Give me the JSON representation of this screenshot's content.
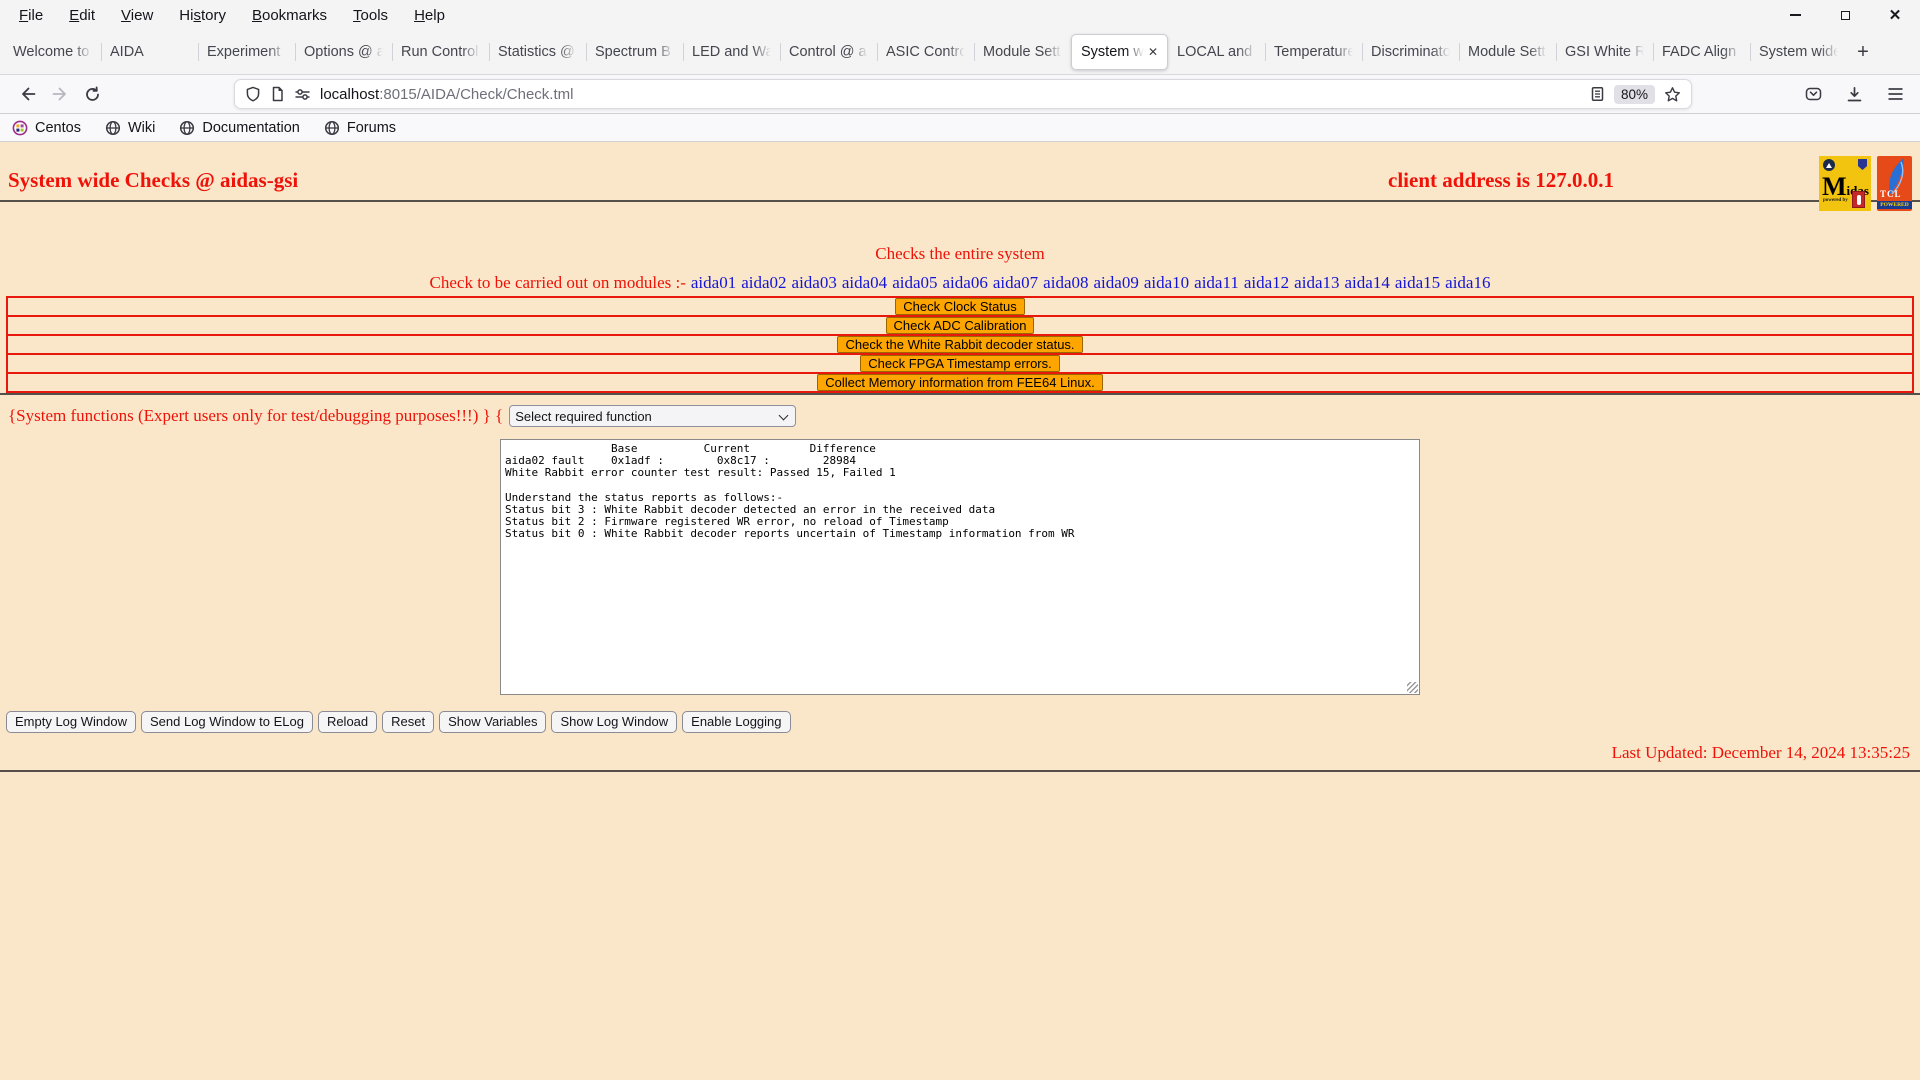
{
  "window": {
    "menu": [
      {
        "label": "File",
        "underline": 0
      },
      {
        "label": "Edit",
        "underline": 0
      },
      {
        "label": "View",
        "underline": 0
      },
      {
        "label": "History",
        "underline": 2
      },
      {
        "label": "Bookmarks",
        "underline": 0
      },
      {
        "label": "Tools",
        "underline": 0
      },
      {
        "label": "Help",
        "underline": 0
      }
    ],
    "controls": {
      "minimize": "minimize",
      "maximize": "maximize",
      "close": "close"
    }
  },
  "tabs": {
    "items": [
      {
        "label": "Welcome to",
        "active": false
      },
      {
        "label": "AIDA",
        "active": false
      },
      {
        "label": "Experiment",
        "active": false
      },
      {
        "label": "Options @ a",
        "active": false
      },
      {
        "label": "Run Control",
        "active": false
      },
      {
        "label": "Statistics @",
        "active": false
      },
      {
        "label": "Spectrum B",
        "active": false
      },
      {
        "label": "LED and Wa",
        "active": false
      },
      {
        "label": "Control @ a",
        "active": false
      },
      {
        "label": "ASIC Contro",
        "active": false
      },
      {
        "label": "Module Sett",
        "active": false
      },
      {
        "label": "System w",
        "active": true
      },
      {
        "label": "LOCAL and",
        "active": false
      },
      {
        "label": "Temperature",
        "active": false
      },
      {
        "label": "Discriminato",
        "active": false
      },
      {
        "label": "Module Sett",
        "active": false
      },
      {
        "label": "GSI White R",
        "active": false
      },
      {
        "label": "FADC Align",
        "active": false
      },
      {
        "label": "System wide",
        "active": false
      }
    ],
    "new_tab": "+",
    "close_glyph": "✕"
  },
  "nav": {
    "url_host": "localhost",
    "url_path": ":8015/AIDA/Check/Check.tml",
    "zoom_badge": "80%"
  },
  "bookmarks": [
    {
      "label": "Centos",
      "icon": "centos-icon"
    },
    {
      "label": "Wiki",
      "icon": "globe-icon"
    },
    {
      "label": "Documentation",
      "icon": "globe-icon"
    },
    {
      "label": "Forums",
      "icon": "globe-icon"
    }
  ],
  "page": {
    "title": "System wide Checks @ aidas-gsi",
    "client_address": "client address is 127.0.0.1",
    "subtitle": "Checks the entire system",
    "modules_prefix": "Check to be carried out on modules :-",
    "modules": [
      "aida01",
      "aida02",
      "aida03",
      "aida04",
      "aida05",
      "aida06",
      "aida07",
      "aida08",
      "aida09",
      "aida10",
      "aida11",
      "aida12",
      "aida13",
      "aida14",
      "aida15",
      "aida16"
    ],
    "check_buttons": [
      "Check Clock Status",
      "Check ADC Calibration",
      "Check the White Rabbit decoder status.",
      "Check FPGA Timestamp errors.",
      "Collect Memory information from FEE64 Linux."
    ],
    "functions_label": "{System functions (Expert users only for test/debugging purposes!!!)  } {",
    "select_value": "Select required function",
    "log_text": "                Base          Current         Difference\naida02 fault    0x1adf :        0x8c17 :        28984\nWhite Rabbit error counter test result: Passed 15, Failed 1\n\nUnderstand the status reports as follows:-\nStatus bit 3 : White Rabbit decoder detected an error in the received data\nStatus bit 2 : Firmware registered WR error, no reload of Timestamp\nStatus bit 0 : White Rabbit decoder reports uncertain of Timestamp information from WR\n",
    "log_buttons": [
      "Empty Log Window",
      "Send Log Window to ELog",
      "Reload",
      "Reset",
      "Show Variables",
      "Show Log Window",
      "Enable Logging"
    ],
    "last_updated": "Last Updated: December 14, 2024 13:35:25",
    "logos": {
      "midas_m": "M",
      "midas_rest": "idas",
      "midas_powered": "powered by",
      "tcl": "TCL",
      "tcl_powered": "POWERED"
    }
  },
  "colors": {
    "page_bg": "#fae7ca",
    "accent_red": "#ee1208",
    "link_blue": "#1414d6",
    "button_orange": "#ffa500",
    "row_border_red": "#e8190c"
  }
}
